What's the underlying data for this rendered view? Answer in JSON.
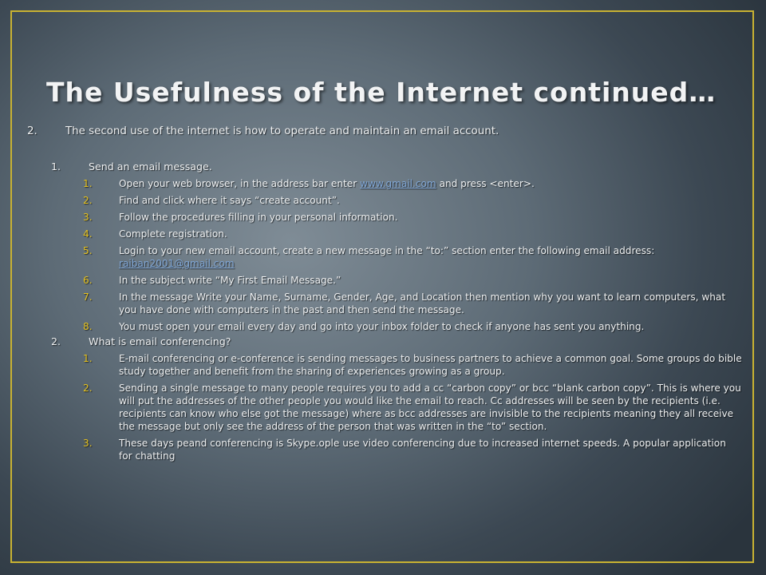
{
  "slide": {
    "title": "The Usefulness of the Internet continued…",
    "main_item": {
      "number": "2.",
      "text": "The second use of the internet is how to operate and maintain an email account."
    },
    "sections": [
      {
        "number": "1.",
        "heading": "Send an email message.",
        "steps": [
          {
            "number": "1.",
            "text_before": "Open your web browser, in the address bar enter ",
            "link": "www.gmail.com",
            "text_after": "  and press <enter>."
          },
          {
            "number": "2.",
            "text": "Find and click where it says “create account”."
          },
          {
            "number": "3.",
            "text": "Follow the procedures filling in your personal information."
          },
          {
            "number": "4.",
            "text": "Complete registration."
          },
          {
            "number": "5.",
            "text": "Login to your new email account, create a new message in the “to:” section enter the following email address:",
            "email": "raiban2001@gmail.com"
          },
          {
            "number": "6.",
            "text": "In the subject write “My First Email Message.”"
          },
          {
            "number": "7.",
            "text": "In the message Write your Name, Surname, Gender, Age, and Location then mention why you want to learn computers, what you have done with computers in the past and then send the message."
          },
          {
            "number": "8.",
            "text": "You must open your email every day and go into your inbox folder to check if anyone has sent you anything."
          }
        ]
      },
      {
        "number": "2.",
        "heading": "What is email conferencing?",
        "steps": [
          {
            "number": "1.",
            "text": "E-mail conferencing or e-conference is sending messages to business  partners to achieve a common goal. Some groups do bible study together and benefit from the sharing of experiences growing as a group."
          },
          {
            "number": "2.",
            "text": "Sending a single message to many people requires you to add a cc “carbon copy” or bcc “blank carbon copy”. This is where you will put the addresses of the other people you would like the email to reach. Cc addresses will be seen by the recipients (i.e. recipients can know  who else got the message) where as bcc addresses are invisible to the recipients meaning  they all receive the message but only see the address of the person that was written in the “to” section."
          },
          {
            "number": "3.",
            "text": "These days peand conferencing is Skype.ople use video conferencing due to increased internet speeds. A popular application for chatting"
          }
        ]
      }
    ]
  },
  "colors": {
    "border": "#c8b232",
    "sub_number": "#e6c21e",
    "link": "#7fa6d6"
  }
}
